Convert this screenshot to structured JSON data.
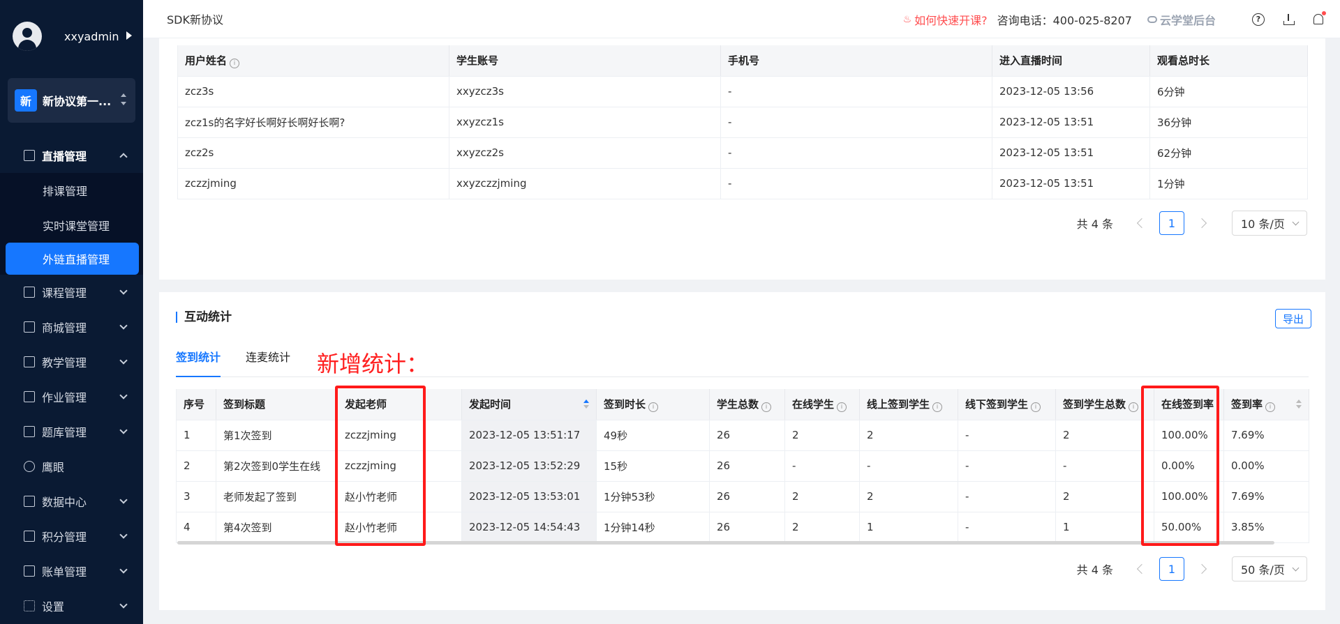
{
  "sidebar": {
    "username": "xxyadmin",
    "app_badge": "新",
    "app_name": "新协议第一...",
    "menu": [
      {
        "label": "直播管理",
        "icon": "tv-icon",
        "open": true,
        "children": [
          {
            "label": "排课管理"
          },
          {
            "label": "实时课堂管理"
          },
          {
            "label": "外链直播管理",
            "active": true
          }
        ]
      },
      {
        "label": "课程管理",
        "icon": "book-icon"
      },
      {
        "label": "商城管理",
        "icon": "shop-icon"
      },
      {
        "label": "教学管理",
        "icon": "teach-icon"
      },
      {
        "label": "作业管理",
        "icon": "homework-icon"
      },
      {
        "label": "题库管理",
        "icon": "question-bank-icon"
      },
      {
        "label": "鹰眼",
        "icon": "eye-icon"
      },
      {
        "label": "数据中心",
        "icon": "chart-icon"
      },
      {
        "label": "积分管理",
        "icon": "star-icon"
      },
      {
        "label": "账单管理",
        "icon": "bill-icon"
      },
      {
        "label": "设置",
        "icon": "grid-icon"
      }
    ]
  },
  "header": {
    "page_name": "SDK新协议",
    "quick_link": "如何快速开课?",
    "phone": "咨询电话：400-025-8207",
    "brand": "云学堂后台"
  },
  "watch_table": {
    "columns": [
      "用户姓名",
      "学生账号",
      "手机号",
      "进入直播时间",
      "观看总时长"
    ],
    "rows": [
      [
        "zcz3s",
        "xxyzcz3s",
        "-",
        "2023-12-05 13:56",
        "6分钟"
      ],
      [
        "zcz1s的名字好长啊好长啊好长啊?",
        "xxyzcz1s",
        "-",
        "2023-12-05 13:51",
        "36分钟"
      ],
      [
        "zcz2s",
        "xxyzcz2s",
        "-",
        "2023-12-05 13:51",
        "62分钟"
      ],
      [
        "zczzjming",
        "xxyzczzjming",
        "-",
        "2023-12-05 13:51",
        "1分钟"
      ]
    ],
    "pager": {
      "total": "共 4 条",
      "page": "1",
      "size": "10 条/页"
    }
  },
  "interaction": {
    "title": "互动统计",
    "export": "导出",
    "tabs": [
      "签到统计",
      "连麦统计"
    ],
    "annotation": "新增统计：",
    "columns": [
      "序号",
      "签到标题",
      "发起老师",
      "发起时间",
      "签到时长",
      "学生总数",
      "在线学生",
      "线上签到学生",
      "线下签到学生",
      "签到学生总数",
      "在线签到率",
      "签到率"
    ],
    "rows": [
      [
        "1",
        "第1次签到",
        "zczzjming",
        "2023-12-05 13:51:17",
        "49秒",
        "26",
        "2",
        "2",
        "-",
        "2",
        "100.00%",
        "7.69%"
      ],
      [
        "2",
        "第2次签到0学生在线",
        "zczzjming",
        "2023-12-05 13:52:29",
        "15秒",
        "26",
        "-",
        "-",
        "-",
        "-",
        "0.00%",
        "0.00%"
      ],
      [
        "3",
        "老师发起了签到",
        "赵小竹老师",
        "2023-12-05 13:53:01",
        "1分钟53秒",
        "26",
        "2",
        "2",
        "-",
        "2",
        "100.00%",
        "7.69%"
      ],
      [
        "4",
        "第4次签到",
        "赵小竹老师",
        "2023-12-05 14:54:43",
        "1分钟14秒",
        "26",
        "2",
        "1",
        "-",
        "1",
        "50.00%",
        "3.85%"
      ]
    ],
    "pager": {
      "total": "共 4 条",
      "page": "1",
      "size": "50 条/页"
    }
  },
  "colors": {
    "accent": "#1677ff",
    "sidebar_bg": "#0a1a33",
    "highlight": "#ff1a1a"
  }
}
